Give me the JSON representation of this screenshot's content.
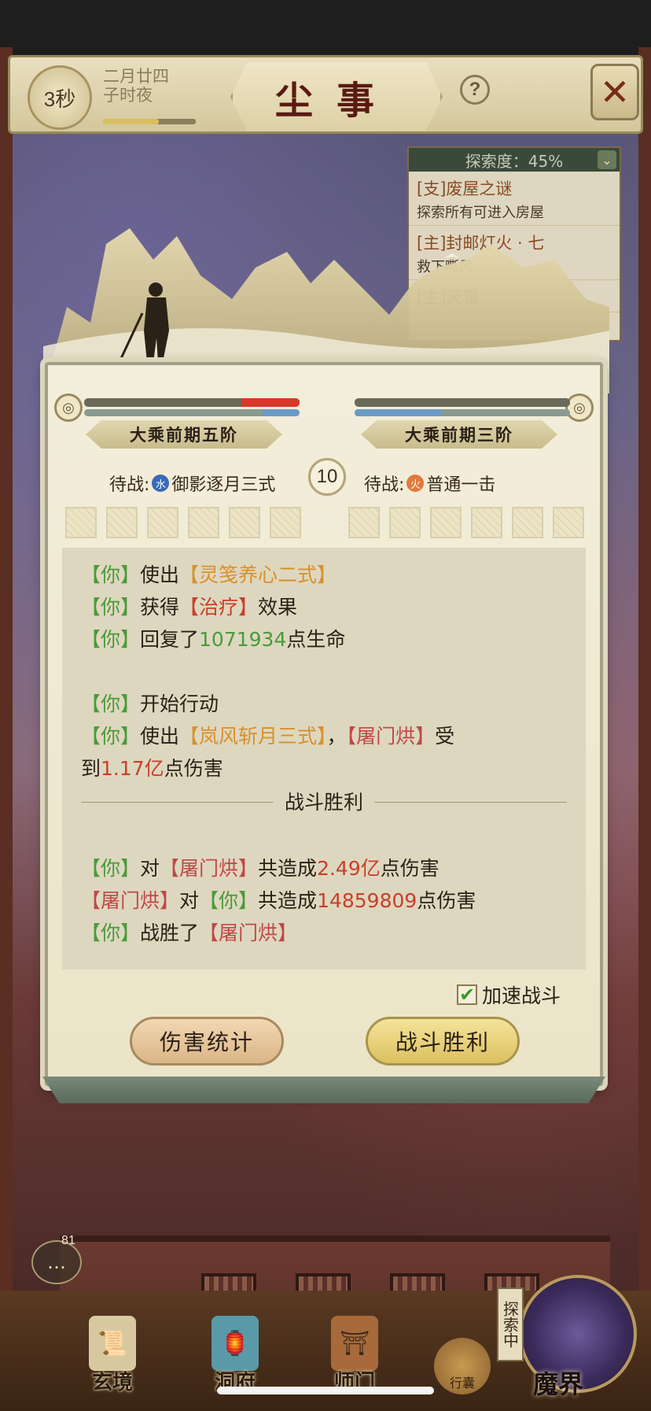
{
  "header": {
    "timer": "3秒",
    "date_line1": "二月廿四",
    "date_line2": "子时夜",
    "title": "尘事",
    "help": "?",
    "time_progress": 0.6
  },
  "explore": {
    "progress_label": "探索度：45%",
    "quests": [
      {
        "title": "[支]废屋之谜",
        "desc": "探索所有可进入房屋"
      },
      {
        "title": "[主]封邮灯火 · 七",
        "desc": "救下嘶风"
      },
      {
        "title": "[主]天雷",
        "desc": ""
      }
    ]
  },
  "battle": {
    "player_rank": "大乘前期五阶",
    "enemy_rank": "大乘前期三阶",
    "round": "10",
    "player_hp": 0.27,
    "player_mp": 0.17,
    "enemy_hp": 0.0,
    "enemy_mp": 0.4,
    "player_pending": {
      "prefix": "待战:",
      "element": "水",
      "skill": "御影逐月三式"
    },
    "enemy_pending": {
      "prefix": "待战:",
      "element": "火",
      "skill": "普通一击"
    }
  },
  "log": {
    "you": "【你】",
    "l1_mid": "使出",
    "l1_skill": "【灵笺养心二式】",
    "l2_mid": "获得",
    "l2_effect": "【治疗】",
    "l2_end": "效果",
    "l3_mid": "回复了",
    "l3_num": "1071934",
    "l3_end": "点生命",
    "l4_mid": "开始行动",
    "l5_mid": "使出",
    "l5_skill": "【岚风斩月三式】",
    "l5_comma": "，",
    "enemy": "【屠门烘】",
    "l5_end": "受",
    "l6_start": "到",
    "l6_num": "1.17亿",
    "l6_end": "点伤害",
    "divider": "战斗胜利",
    "s1_mid": "对",
    "s1_mid2": "共造成",
    "s1_num": "2.49亿",
    "s1_end": "点伤害",
    "s2_num": "14859809",
    "s3_mid": "战胜了"
  },
  "controls": {
    "speed_label": "加速战斗",
    "speed_checked": "✔",
    "stats_button": "伤害统计",
    "victory_button": "战斗胜利"
  },
  "nav": {
    "chat_count": "81",
    "items": [
      "玄境",
      "洞府",
      "师门"
    ],
    "bag": "行囊",
    "explore_tag": "探索中",
    "demon": "魔界"
  }
}
